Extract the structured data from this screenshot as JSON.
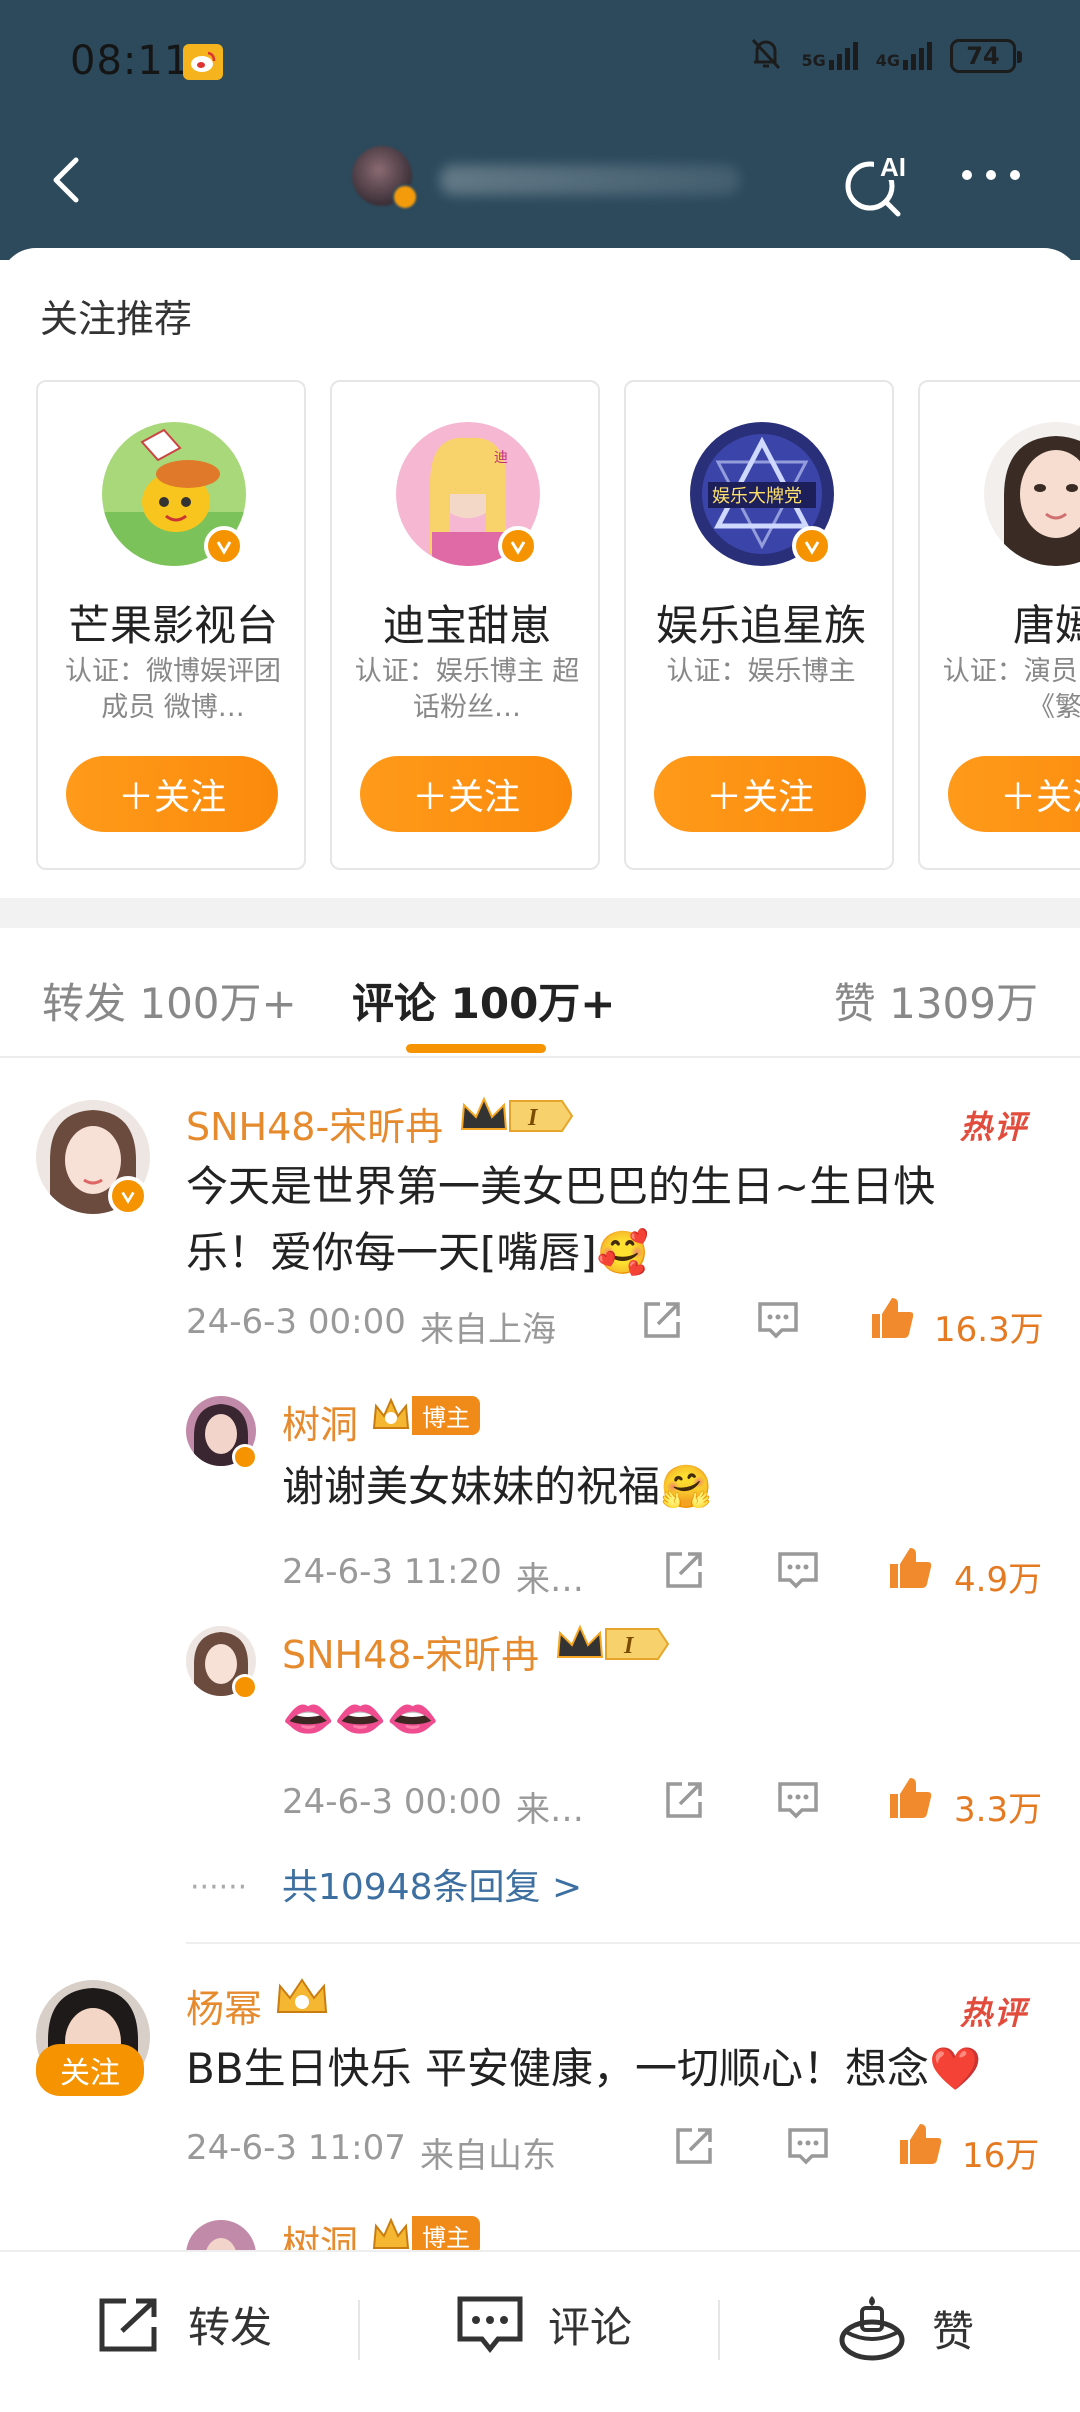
{
  "status_bar": {
    "time": "08:11",
    "network_1": "5G",
    "network_2": "4G",
    "battery": "74"
  },
  "header": {
    "back_icon": "chevron-left-icon",
    "ai_label": "AI",
    "more_icon": "more-dots-icon"
  },
  "recommend": {
    "title": "关注推荐",
    "follow_label": "＋关注",
    "cards": [
      {
        "name": "芒果影视台",
        "desc": "认证：微博娱评团成员 微博…"
      },
      {
        "name": "迪宝甜崽",
        "desc": "认证：娱乐博主 超话粉丝…"
      },
      {
        "name": "娱乐追星族",
        "desc": "认证：娱乐博主"
      },
      {
        "name": "唐嫣",
        "desc": "认证：演员 代表作《繁"
      }
    ]
  },
  "tabs": {
    "repost": "转发 100万+",
    "comment": "评论 100万+",
    "like": "赞 1309万"
  },
  "comments": [
    {
      "user": "SNH48-宋昕冉",
      "level": "I",
      "hot_label": "热评",
      "text": "今天是世界第一美女巴巴的生日~生日快乐！爱你每一天[嘴唇]🥰",
      "time": "24-6-3 00:00",
      "location": "来自上海",
      "likes": "16.3万",
      "replies": [
        {
          "user": "树洞",
          "badge": "博主",
          "text": "谢谢美女妹妹的祝福🤗",
          "time": "24-6-3 11:20",
          "location": "来…",
          "likes": "4.9万"
        },
        {
          "user": "SNH48-宋昕冉",
          "level": "I",
          "text": "👄👄👄",
          "time": "24-6-3 00:00",
          "location": "来…",
          "likes": "3.3万"
        }
      ],
      "more_replies": "共10948条回复 >"
    },
    {
      "user": "杨幂",
      "hot_label": "热评",
      "follow_tag": "关注",
      "text": "BB生日快乐 平安健康，一切顺心！想念❤️",
      "time": "24-6-3 11:07",
      "location": "来自山东",
      "likes": "16万",
      "peek_user": "树洞",
      "peek_badge": "博主"
    }
  ],
  "bottom_bar": {
    "repost": "转发",
    "comment": "评论",
    "like": "赞"
  },
  "colors": {
    "header_bg": "#2c4a5c",
    "accent_orange": "#f59300",
    "username_orange": "#e68a2e",
    "link_blue": "#3d6fa0",
    "hot_red": "#e24c3c"
  }
}
